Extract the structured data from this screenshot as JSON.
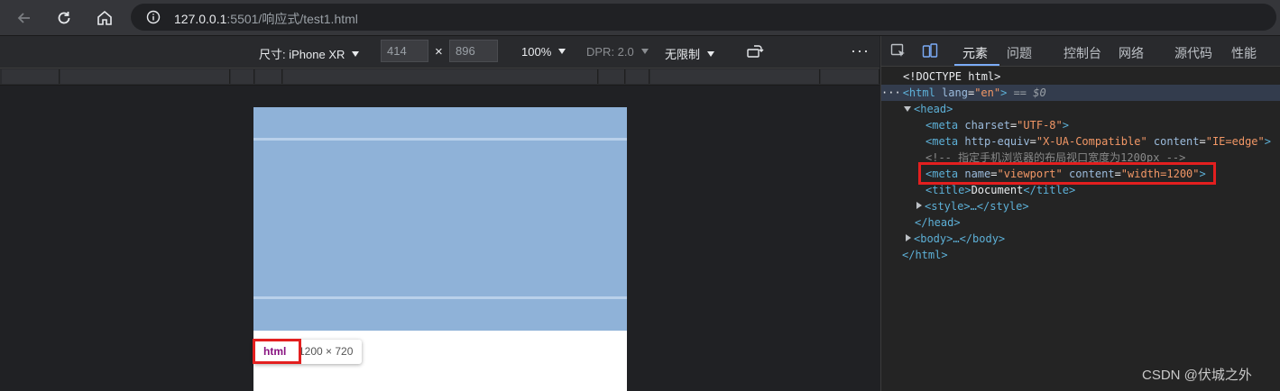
{
  "browser": {
    "url_host": "127.0.0.1",
    "url_rest": ":5501/响应式/test1.html"
  },
  "device_toolbar": {
    "size_label": "尺寸: iPhone XR",
    "width": "414",
    "times": "×",
    "height": "896",
    "zoom": "100%",
    "dpr": "DPR: 2.0",
    "throttle": "无限制",
    "more": "⋮"
  },
  "devtools": {
    "tabs": [
      "元素",
      "问题",
      "控制台",
      "网络",
      "源代码",
      "性能"
    ],
    "lines": {
      "doctype": "<!DOCTYPE html>",
      "html_open_tag": "<html",
      "html_attr_name": "lang",
      "html_attr_value": "\"en\"",
      "html_selected_marker": "== $0",
      "head_open": "<head>",
      "meta1_tag": "<meta",
      "meta1_attr": "charset",
      "meta1_value": "\"UTF-8\"",
      "meta2_tag": "<meta",
      "meta2_attr1": "http-equiv",
      "meta2_value1": "\"X-UA-Compatible\"",
      "meta2_attr2": "content",
      "meta2_value2": "\"IE=edge\"",
      "comment": "<!-- 指定手机浏览器的布局视口宽度为1200px -->",
      "meta3_tag": "<meta",
      "meta3_attr1": "name",
      "meta3_value1": "\"viewport\"",
      "meta3_attr2": "content",
      "meta3_value2": "\"width=1200\"",
      "title_open": "<title>",
      "title_text": "Document",
      "title_close": "</title>",
      "style_collapsed": "<style>…</style>",
      "head_close": "</head>",
      "body_collapsed": "<body>…</body>",
      "html_close": "</html>"
    }
  },
  "tooltip": {
    "tag": "html",
    "size": "1200 × 720"
  },
  "watermark": "CSDN @伏城之外",
  "colors": {
    "viewport_blue": "#8fb2d8",
    "highlight_red": "#e31f1f"
  }
}
